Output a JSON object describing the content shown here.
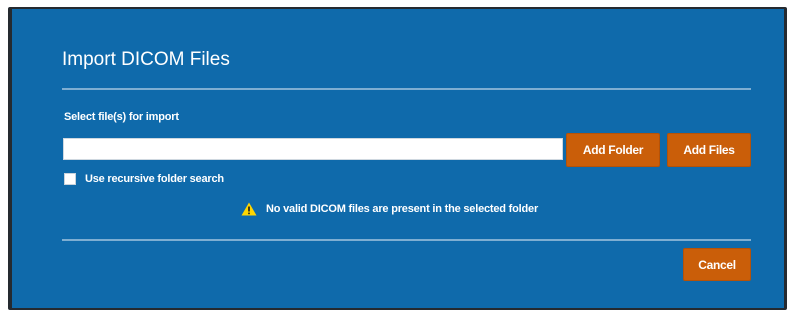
{
  "dialog": {
    "title": "Import DICOM Files",
    "select_label": "Select file(s) for import",
    "path_value": "",
    "add_folder_label": "Add Folder",
    "add_files_label": "Add Files",
    "recursive_label": "Use recursive folder search",
    "recursive_checked": false,
    "warning_text": "No valid DICOM files are present in the selected folder",
    "cancel_label": "Cancel"
  },
  "icons": {
    "warning": "warning-icon"
  },
  "colors": {
    "dialog_background": "#0f6aab",
    "button": "#ca5e09",
    "warning_icon": "#ffd600"
  }
}
